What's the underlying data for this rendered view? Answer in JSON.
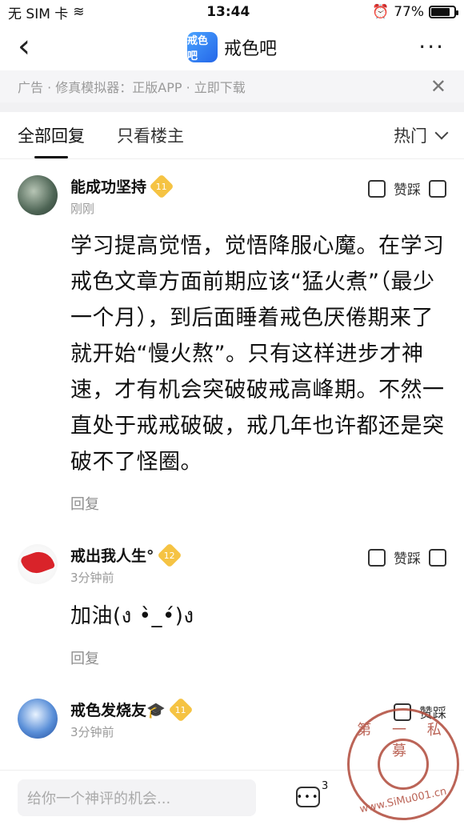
{
  "status_bar": {
    "carrier": "无 SIM 卡",
    "time": "13:44",
    "battery": "77%"
  },
  "nav": {
    "logo_text": "戒色吧",
    "title": "戒色吧"
  },
  "ad": {
    "text": "广告 · 修真模拟器：正版APP · 立即下载"
  },
  "tabs": {
    "all": "全部回复",
    "op": "只看楼主",
    "sort": "热门"
  },
  "posts": [
    {
      "author": "能成功坚持",
      "level": "11",
      "time": "刚刚",
      "vote_label": "赞踩",
      "content": "学习提高觉悟，觉悟降服心魔。在学习戒色文章方面前期应该“猛火煮”（最少一个月），到后面睡着戒色厌倦期来了就开始“慢火熬”。只有这样进步才神速，才有机会突破破戒高峰期。不然一直处于戒戒破破，戒几年也许都还是突破不了怪圈。",
      "reply": "回复"
    },
    {
      "author": "戒出我人生°",
      "level": "12",
      "time": "3分钟前",
      "vote_label": "赞踩",
      "content": "加油(ง •̀_•́)ง",
      "reply": "回复"
    },
    {
      "author": "戒色发烧友🎓",
      "level": "11",
      "time": "3分钟前",
      "vote_label": "赞踩"
    }
  ],
  "bottom": {
    "placeholder": "给你一个神评的机会...",
    "comment_count": "3"
  },
  "watermark": {
    "top": "第 一 私 募",
    "bottom": "www.SiMu001.cn"
  }
}
